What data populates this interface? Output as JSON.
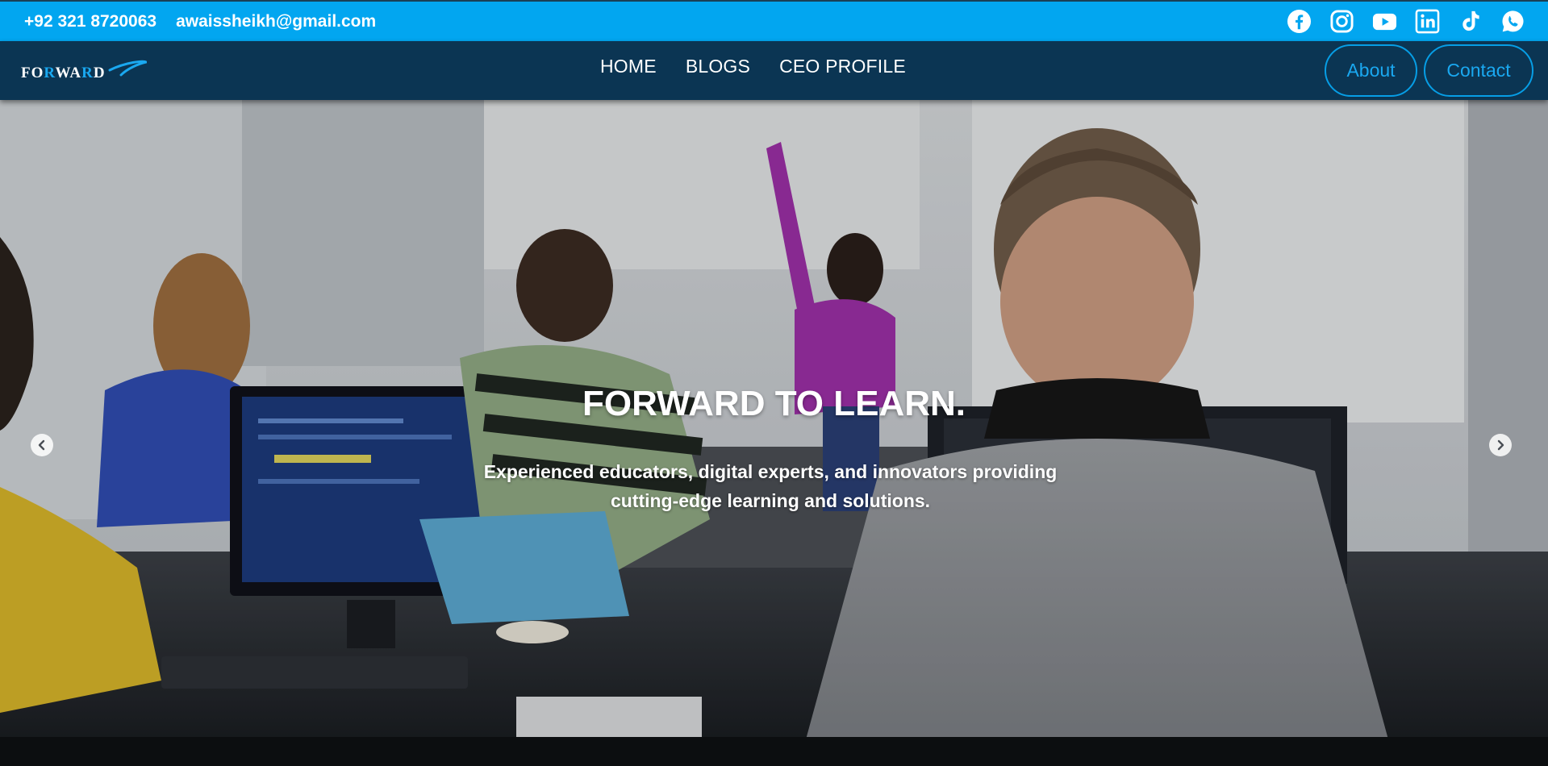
{
  "topbar": {
    "phone": "+92 321 8720063",
    "email": "awaissheikh@gmail.com",
    "socials": [
      {
        "name": "facebook",
        "icon": "facebook-icon"
      },
      {
        "name": "instagram",
        "icon": "instagram-icon"
      },
      {
        "name": "youtube",
        "icon": "youtube-icon"
      },
      {
        "name": "linkedin",
        "icon": "linkedin-icon"
      },
      {
        "name": "tiktok",
        "icon": "tiktok-icon"
      },
      {
        "name": "whatsapp",
        "icon": "whatsapp-icon"
      }
    ]
  },
  "navbar": {
    "logo_text": "FORWARD",
    "menu": [
      {
        "label": "HOME"
      },
      {
        "label": "BLOGS"
      },
      {
        "label": "CEO PROFILE"
      }
    ],
    "about_label": "About",
    "contact_label": "Contact"
  },
  "hero": {
    "title": "FORWARD TO LEARN.",
    "subtitle": "Experienced educators, digital experts, and innovators providing cutting-edge learning and solutions.",
    "prev_icon": "chevron-left-icon",
    "next_icon": "chevron-right-icon"
  },
  "colors": {
    "topbar_bg": "#02a6f0",
    "navbar_bg": "#0b3553",
    "accent": "#069ee6",
    "logo_accent": "#1aa8f0"
  }
}
